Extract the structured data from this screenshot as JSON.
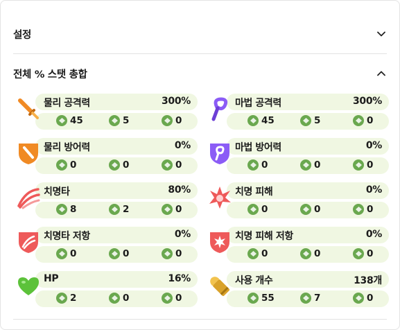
{
  "sections": {
    "settings": {
      "title": "설정"
    },
    "total": {
      "title": "전체 % 스탯 총합"
    }
  },
  "stats": [
    {
      "name": "물리 공격력",
      "value": "300%",
      "sub": [
        "45",
        "5",
        "0"
      ],
      "icon": "sword-icon"
    },
    {
      "name": "마법 공격력",
      "value": "300%",
      "sub": [
        "45",
        "5",
        "0"
      ],
      "icon": "staff-icon"
    },
    {
      "name": "물리 방어력",
      "value": "0%",
      "sub": [
        "0",
        "0",
        "0"
      ],
      "icon": "sword-shield-icon"
    },
    {
      "name": "마법 방어력",
      "value": "0%",
      "sub": [
        "0",
        "0",
        "0"
      ],
      "icon": "staff-shield-icon"
    },
    {
      "name": "치명타",
      "value": "80%",
      "sub": [
        "8",
        "2",
        "0"
      ],
      "icon": "claw-icon"
    },
    {
      "name": "치명 피해",
      "value": "0%",
      "sub": [
        "0",
        "0",
        "0"
      ],
      "icon": "burst-icon"
    },
    {
      "name": "치명타 저항",
      "value": "0%",
      "sub": [
        "0",
        "0",
        "0"
      ],
      "icon": "claw-shield-icon"
    },
    {
      "name": "치명 피해 저항",
      "value": "0%",
      "sub": [
        "0",
        "0",
        "0"
      ],
      "icon": "burst-shield-icon"
    },
    {
      "name": "HP",
      "value": "16%",
      "sub": [
        "2",
        "0",
        "0"
      ],
      "icon": "heart-icon"
    },
    {
      "name": "사용 개수",
      "value": "138개",
      "sub": [
        "55",
        "7",
        "0"
      ],
      "icon": "bullet-icon"
    }
  ],
  "colors": {
    "card_bg": "#f0f7e2",
    "gem": "#6aa84f",
    "icon_orange": "#f08a24",
    "icon_purple": "#8b5cf6",
    "icon_red": "#ee5a5a",
    "icon_green": "#5cc23a"
  }
}
